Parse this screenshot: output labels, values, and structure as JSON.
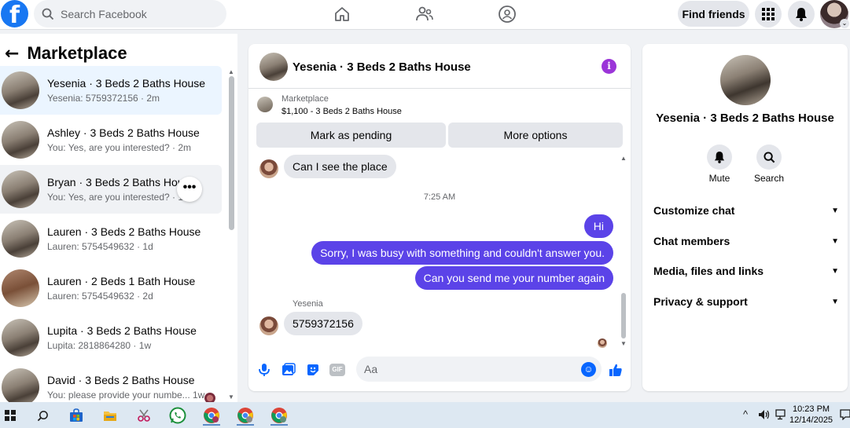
{
  "topbar": {
    "logo_letter": "f",
    "search_placeholder": "Search Facebook",
    "find_friends": "Find friends",
    "nav_icons": [
      "home-icon",
      "friends-icon",
      "groups-icon"
    ]
  },
  "left": {
    "title": "Marketplace",
    "conversations": [
      {
        "title": "Yesenia · 3 Beds 2 Baths House",
        "subtitle": "Yesenia: 5759372156 · 2m",
        "state": "active"
      },
      {
        "title": "Ashley · 3 Beds 2 Baths House",
        "subtitle": "You: Yes, are you interested? · 2m",
        "state": ""
      },
      {
        "title": "Bryan · 3 Beds 2 Baths House",
        "subtitle": "You: Yes, are you interested? · 1d",
        "state": "hover"
      },
      {
        "title": "Lauren · 3 Beds 2 Baths House",
        "subtitle": "Lauren: 5754549632 · 1d",
        "state": ""
      },
      {
        "title": "Lauren · 2 Beds 1 Bath House",
        "subtitle": "Lauren: 5754549632 · 2d",
        "state": ""
      },
      {
        "title": "Lupita · 3 Beds 2 Baths House",
        "subtitle": "Lupita: 2818864280 · 1w",
        "state": ""
      },
      {
        "title": "David · 3 Beds 2 Baths House",
        "subtitle": "You: please provide your numbe... 1w",
        "state": ""
      }
    ],
    "more_glyph": "•••"
  },
  "chat": {
    "header_name": "Yesenia · 3 Beds 2 Baths House",
    "info_glyph": "i",
    "marketplace_label": "Marketplace",
    "listing": "$1,100 - 3 Beds 2 Baths House",
    "mark_pending": "Mark as pending",
    "more_options": "More options",
    "messages": {
      "in_1": "Can I see the place",
      "timestamp": "7:25 AM",
      "out_1": "Hi",
      "out_2": "Sorry, I was busy with something and couldn't answer you.",
      "out_3": "Can you send me your number again",
      "sender": "Yesenia",
      "in_2": "5759372156"
    },
    "composer_placeholder": "Aa",
    "composer_icons": [
      "microphone-icon",
      "photo-icon",
      "sticker-icon",
      "gif-icon"
    ],
    "gif_label": "GIF"
  },
  "right": {
    "name": "Yesenia · 3 Beds 2 Baths House",
    "mute_label": "Mute",
    "search_label": "Search",
    "sections": [
      "Customize chat",
      "Chat members",
      "Media, files and links",
      "Privacy & support"
    ]
  },
  "taskbar": {
    "time": "10:23 PM",
    "date": "12/14/2025"
  },
  "colors": {
    "brand_blue": "#1877f2",
    "outgoing_bubble": "#5b43e8",
    "info_purple": "#9b35d8",
    "active_conversation": "#ebf5ff"
  }
}
